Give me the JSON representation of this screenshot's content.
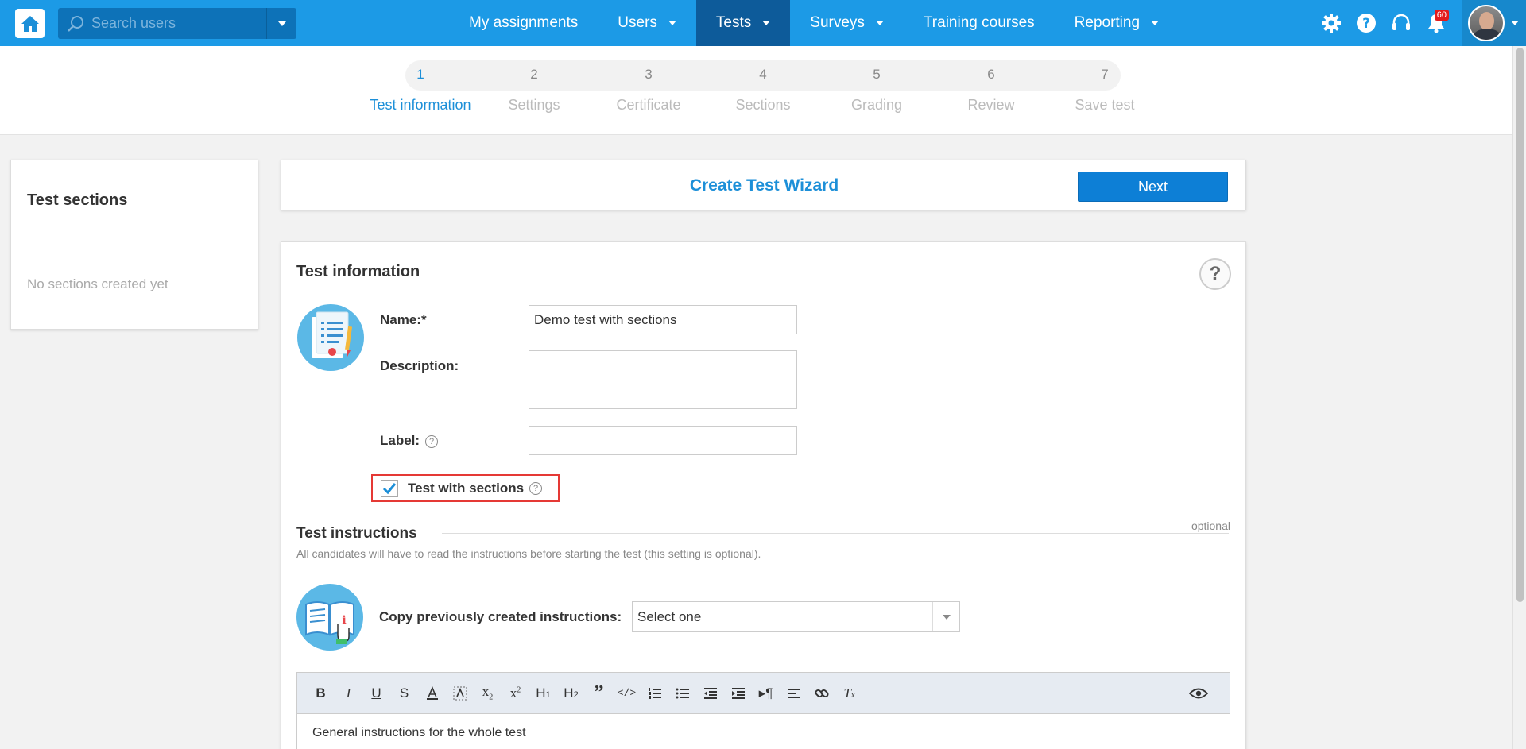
{
  "topbar": {
    "search_placeholder": "Search users",
    "nav": [
      {
        "label": "My assignments"
      },
      {
        "label": "Users"
      },
      {
        "label": "Tests"
      },
      {
        "label": "Surveys"
      },
      {
        "label": "Training courses"
      },
      {
        "label": "Reporting"
      }
    ],
    "notification_count": "60"
  },
  "wizard": {
    "steps": [
      {
        "num": "1",
        "label": "Test information"
      },
      {
        "num": "2",
        "label": "Settings"
      },
      {
        "num": "3",
        "label": "Certificate"
      },
      {
        "num": "4",
        "label": "Sections"
      },
      {
        "num": "5",
        "label": "Grading"
      },
      {
        "num": "6",
        "label": "Review"
      },
      {
        "num": "7",
        "label": "Save test"
      }
    ],
    "title": "Create Test Wizard",
    "next_label": "Next"
  },
  "sidebar": {
    "title": "Test sections",
    "empty_text": "No sections created yet"
  },
  "form": {
    "section_title": "Test information",
    "help_glyph": "?",
    "name_label": "Name:*",
    "name_value": "Demo test with sections",
    "description_label": "Description:",
    "label_label": "Label:",
    "sections_checkbox_label": "Test with sections",
    "instructions_title": "Test instructions",
    "instructions_optional": "optional",
    "instructions_desc": "All candidates will have to read the instructions before starting the test (this setting is optional).",
    "copy_label": "Copy previously created instructions:",
    "copy_select_value": "Select one",
    "editor_text": "General instructions for the whole test"
  },
  "colors": {
    "topbar": "#1c9ae6",
    "accent": "#1c8fd8",
    "next_button": "#0d7fd6",
    "checkbox_highlight": "#e53935"
  }
}
